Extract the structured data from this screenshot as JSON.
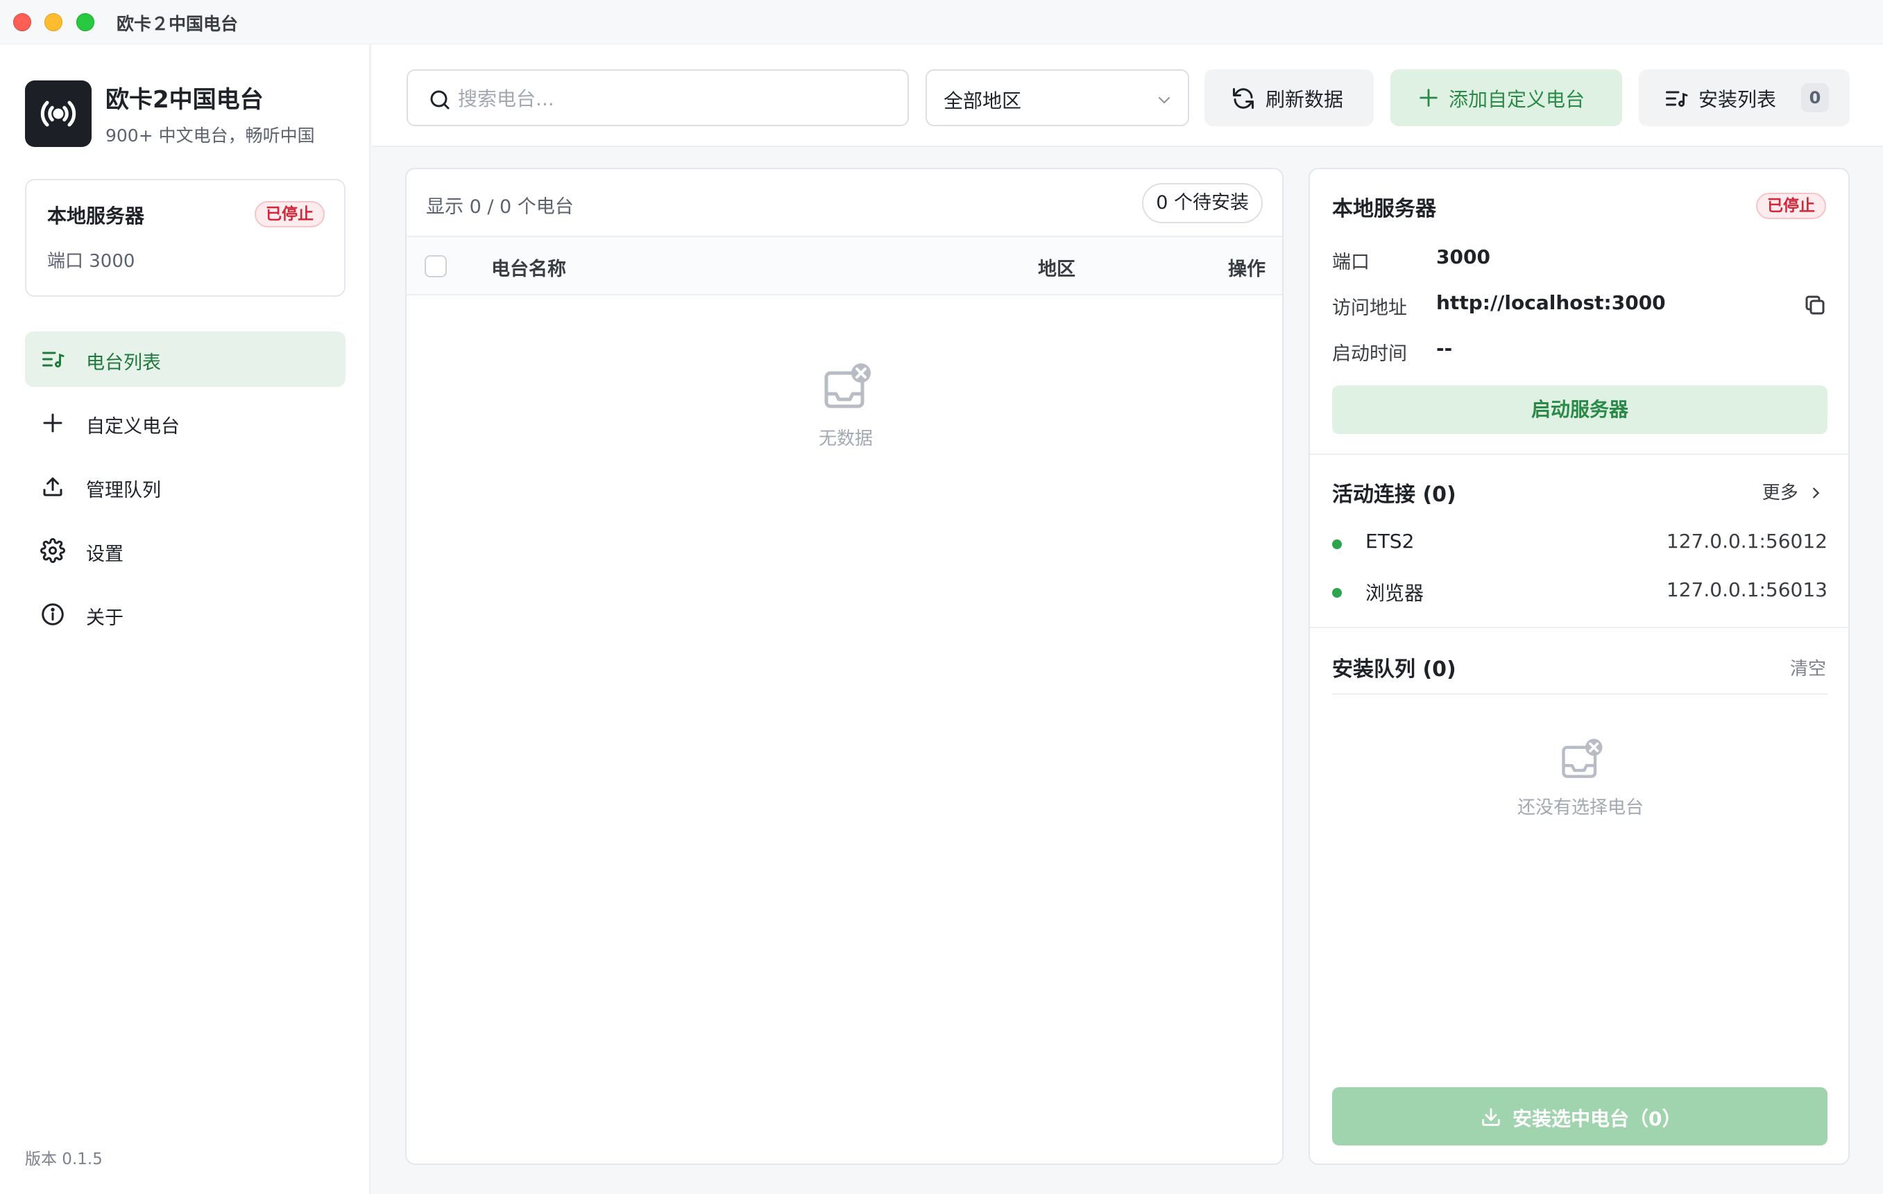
{
  "window": {
    "title": "欧卡２中国电台"
  },
  "sidebar": {
    "app_name": "欧卡2中国电台",
    "app_subtitle": "900+ 中文电台，畅听中国",
    "server_card": {
      "title": "本地服务器",
      "status": "已停止",
      "port_text": "端口 3000"
    },
    "nav": [
      {
        "label": "电台列表",
        "icon": "list-music-icon",
        "active": true
      },
      {
        "label": "自定义电台",
        "icon": "plus-icon",
        "active": false
      },
      {
        "label": "管理队列",
        "icon": "upload-icon",
        "active": false
      },
      {
        "label": "设置",
        "icon": "gear-icon",
        "active": false
      },
      {
        "label": "关于",
        "icon": "info-icon",
        "active": false
      }
    ],
    "version": "版本 0.1.5"
  },
  "toolbar": {
    "search_placeholder": "搜索电台...",
    "region_select": "全部地区",
    "refresh_label": "刷新数据",
    "add_custom_label": "添加自定义电台",
    "install_list_label": "安装列表",
    "install_list_count": "0"
  },
  "list": {
    "showing": "显示 0 / 0 个电台",
    "pending": "0 个待安装",
    "columns": [
      "电台名称",
      "地区",
      "操作"
    ],
    "empty_text": "无数据"
  },
  "server": {
    "title": "本地服务器",
    "status": "已停止",
    "port_key": "端口",
    "port_val": "3000",
    "url_key": "访问地址",
    "url_val": "http://localhost:3000",
    "start_key": "启动时间",
    "start_val": "--",
    "start_button": "启动服务器"
  },
  "connections": {
    "title": "活动连接 (0)",
    "more": "更多",
    "items": [
      {
        "name": "ETS2",
        "addr": "127.0.0.1:56012"
      },
      {
        "name": "浏览器",
        "addr": "127.0.0.1:56013"
      }
    ]
  },
  "install_queue": {
    "title": "安装队列 (0)",
    "clear": "清空",
    "empty_text": "还没有选择电台",
    "install_button": "安装选中电台（0）"
  },
  "colors": {
    "accent_green": "#2b8a47",
    "accent_green_bg": "#dff1e3",
    "stop_red": "#d0273a",
    "online_dot": "#2ea44f"
  }
}
